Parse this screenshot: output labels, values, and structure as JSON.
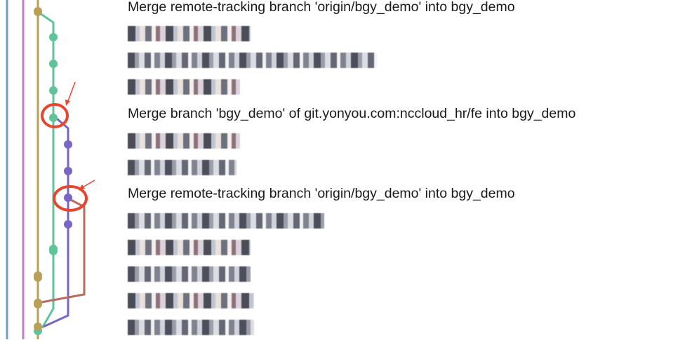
{
  "colors": {
    "blue_rail": "#6e9fbf",
    "magenta_rail": "#c27bc8",
    "olive_branch": "#b8a058",
    "green_branch": "#5ec59b",
    "purple_branch": "#7a65c4",
    "rust_branch": "#b86a5e",
    "annotation_red": "#e8452f",
    "text": "#1a1a1a"
  },
  "commits": [
    {
      "message": "Merge remote-tracking branch 'origin/bgy_demo' into bgy_demo",
      "redacted": false
    },
    {
      "message": "",
      "redacted": true
    },
    {
      "message": "",
      "redacted": true
    },
    {
      "message": "",
      "redacted": true
    },
    {
      "message": "Merge branch 'bgy_demo' of git.yonyou.com:nccloud_hr/fe into bgy_demo",
      "redacted": false
    },
    {
      "message": "",
      "redacted": true
    },
    {
      "message": "",
      "redacted": true
    },
    {
      "message": "Merge remote-tracking branch 'origin/bgy_demo' into bgy_demo",
      "redacted": false
    },
    {
      "message": "",
      "redacted": true
    },
    {
      "message": "",
      "redacted": true
    },
    {
      "message": "",
      "redacted": true
    },
    {
      "message": "",
      "redacted": true
    },
    {
      "message": "",
      "redacted": true
    }
  ],
  "annotations": [
    {
      "type": "circle-with-arrow",
      "target_commit": 4
    },
    {
      "type": "circle-with-arrow",
      "target_commit": 7
    }
  ]
}
